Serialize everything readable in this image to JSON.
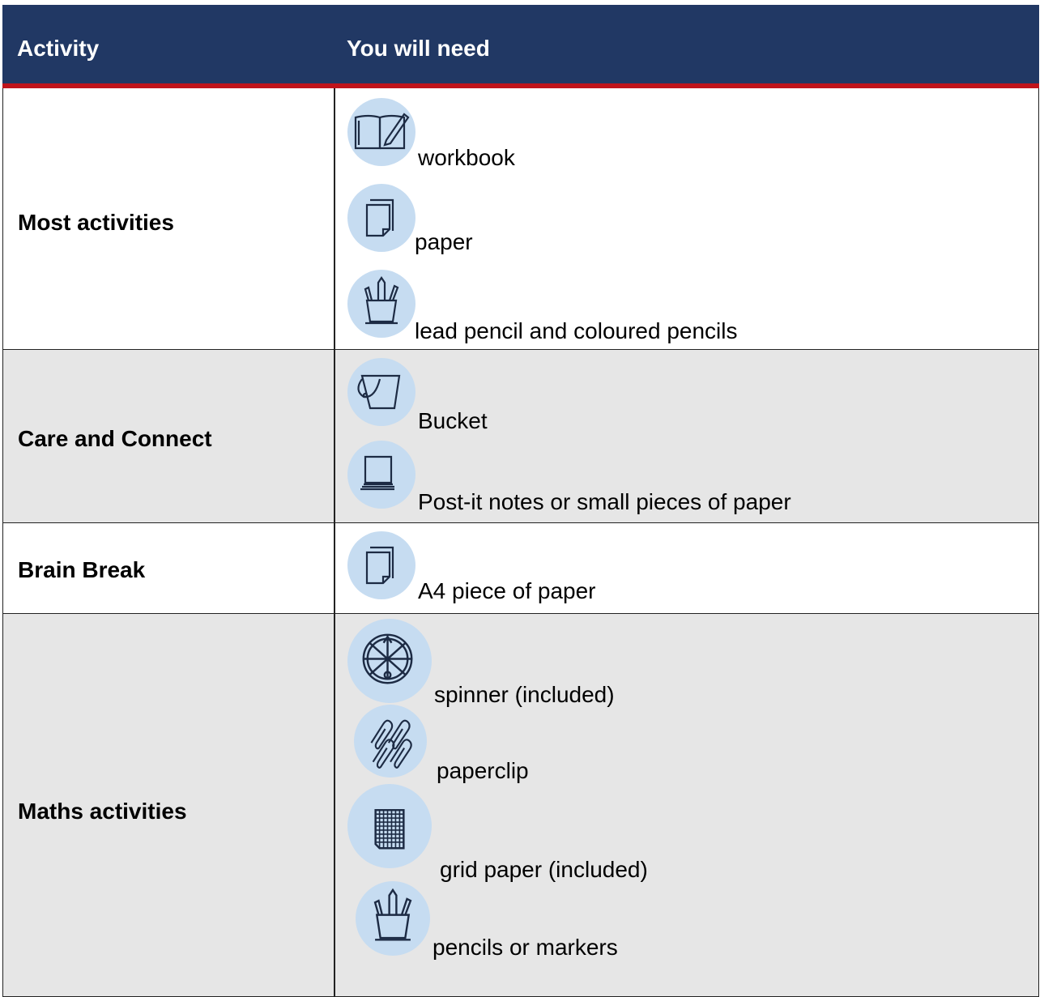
{
  "header": {
    "activity": "Activity",
    "need": "You will need"
  },
  "rows": [
    {
      "label": "Most activities",
      "items": [
        {
          "icon": "workbook-icon",
          "text": "workbook"
        },
        {
          "icon": "paper-icon",
          "text": "paper"
        },
        {
          "icon": "pencil-cup-icon",
          "text": "lead pencil and coloured pencils"
        }
      ]
    },
    {
      "label": "Care and Connect",
      "items": [
        {
          "icon": "bucket-icon",
          "text": "Bucket"
        },
        {
          "icon": "post-it-notes-icon",
          "text": "Post-it notes or small pieces of paper"
        }
      ]
    },
    {
      "label": "Brain Break",
      "items": [
        {
          "icon": "paper-icon",
          "text": "A4 piece of paper"
        }
      ]
    },
    {
      "label": "Maths activities",
      "items": [
        {
          "icon": "spinner-icon",
          "text": "spinner (included)"
        },
        {
          "icon": "paperclip-icon",
          "text": "paperclip"
        },
        {
          "icon": "grid-paper-icon",
          "text": "grid paper (included)"
        },
        {
          "icon": "pencil-cup-icon",
          "text": "pencils or markers"
        }
      ]
    }
  ],
  "colors": {
    "header_bg": "#213864",
    "header_rule": "#c0141b",
    "icon_circle": "#c6dcf1",
    "alt_row": "#e6e6e6"
  }
}
